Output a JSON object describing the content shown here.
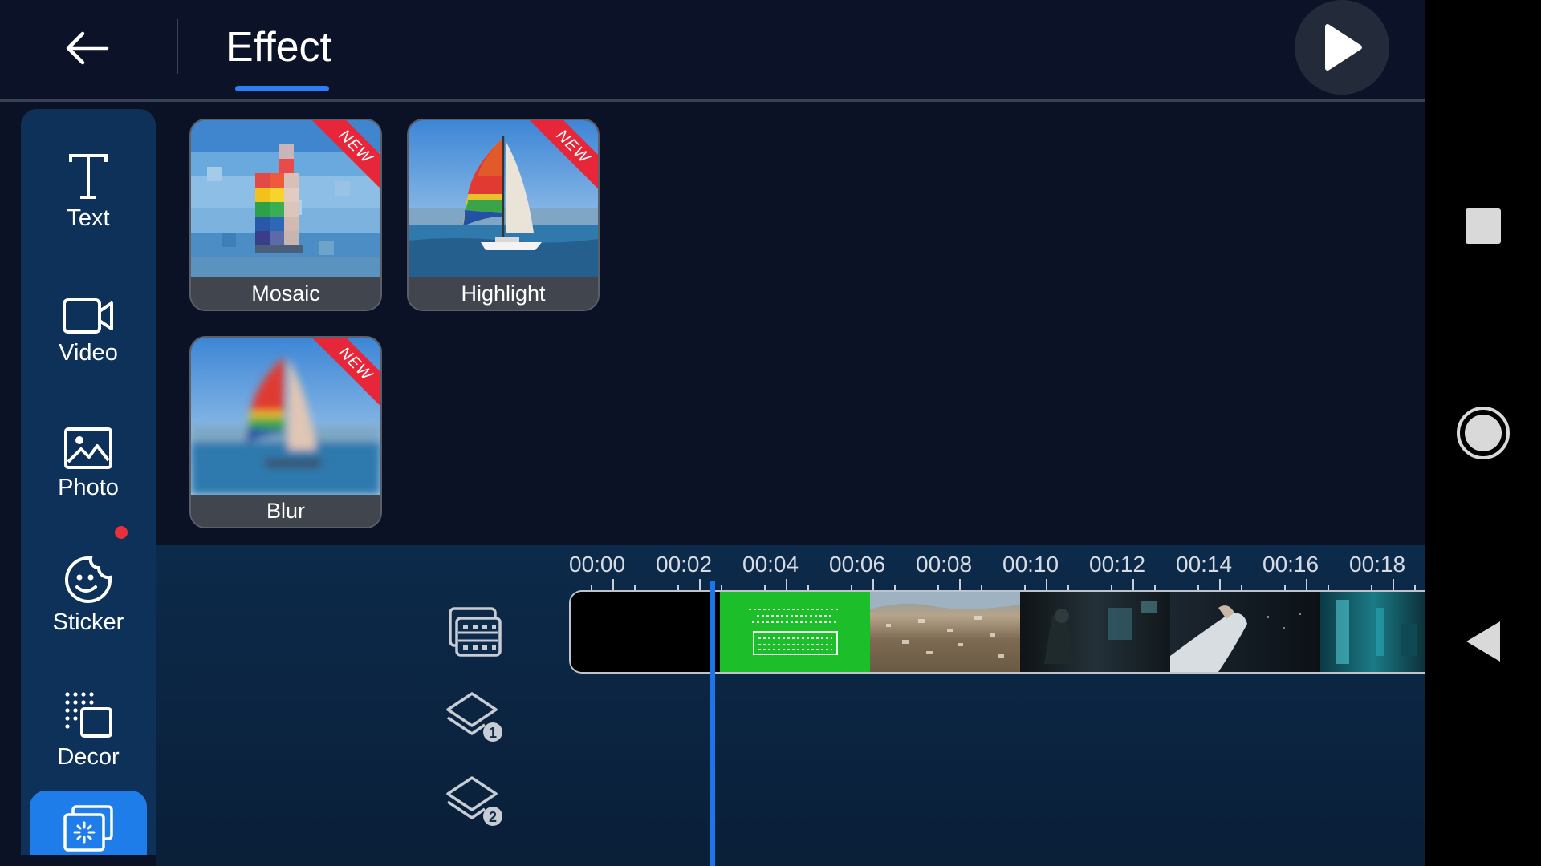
{
  "header": {
    "title": "Effect"
  },
  "sidebar": {
    "items": [
      {
        "label": "Text",
        "icon": "text-icon"
      },
      {
        "label": "Video",
        "icon": "video-icon"
      },
      {
        "label": "Photo",
        "icon": "photo-icon"
      },
      {
        "label": "Sticker",
        "icon": "sticker-icon"
      },
      {
        "label": "Decor",
        "icon": "decor-icon"
      }
    ],
    "active_icon": "effect-icon"
  },
  "effects": [
    {
      "label": "Mosaic",
      "badge": "NEW"
    },
    {
      "label": "Highlight",
      "badge": "NEW"
    },
    {
      "label": "Blur",
      "badge": "NEW"
    }
  ],
  "timeline": {
    "ruler": [
      "00:00",
      "00:02",
      "00:04",
      "00:06",
      "00:08",
      "00:10",
      "00:12",
      "00:14",
      "00:16",
      "00:18"
    ],
    "track_icons": [
      "video-track-icon",
      "layer-1-icon",
      "layer-2-icon"
    ],
    "layer_numbers": [
      "1",
      "2"
    ]
  },
  "colors": {
    "accent": "#2f7df6",
    "background": "#0b1226",
    "sidebar": "#0d3158",
    "new_badge": "#e8263a"
  }
}
